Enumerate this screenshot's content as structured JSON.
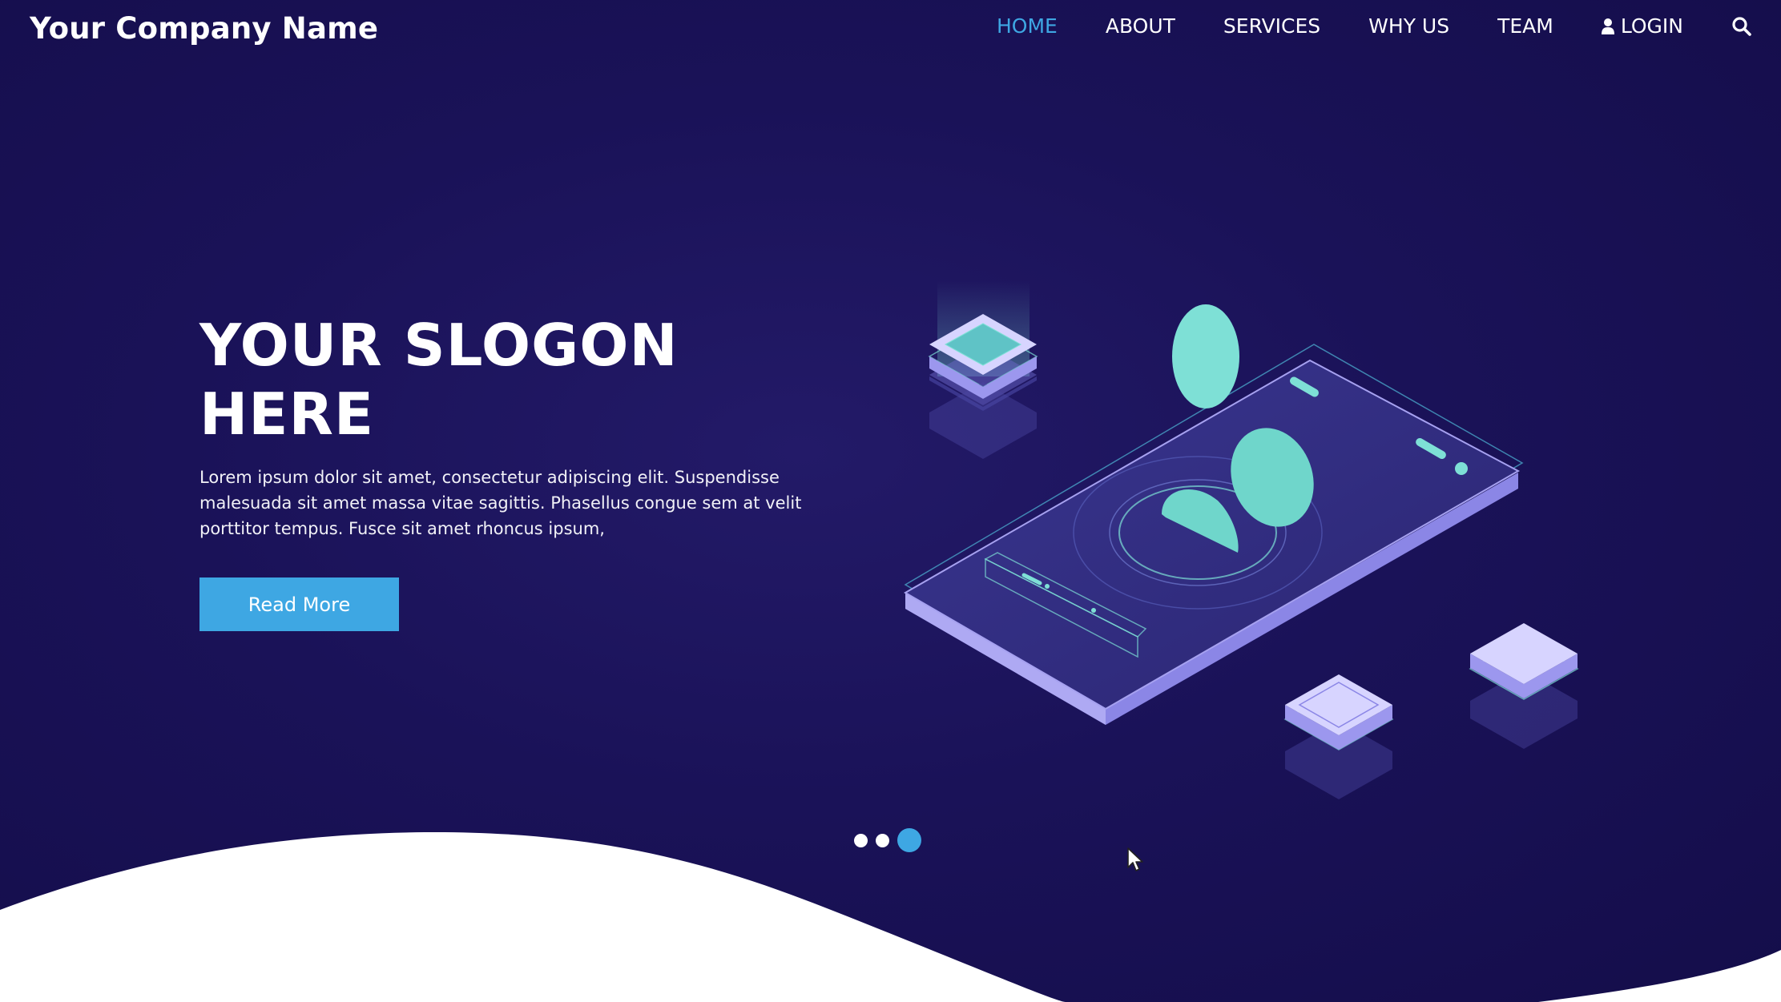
{
  "header": {
    "brand": "Your Company Name",
    "nav": [
      {
        "label": "HOME",
        "active": true
      },
      {
        "label": "ABOUT"
      },
      {
        "label": "SERVICES"
      },
      {
        "label": "WHY US"
      },
      {
        "label": "TEAM"
      }
    ],
    "login_label": "LOGIN",
    "login_icon": "user-icon",
    "search_icon": "search-icon"
  },
  "hero": {
    "title_line1": "YOUR SLOGON",
    "title_line2": "HERE",
    "text": "Lorem ipsum dolor sit amet, consectetur adipiscing elit. Suspendisse malesuada sit amet massa vitae sagittis. Phasellus congue sem at velit porttitor tempus. Fusce sit amet rhoncus ipsum,",
    "button_label": "Read More"
  },
  "slider": {
    "slides": 3,
    "active_index": 2
  },
  "colors": {
    "accent": "#3ea7e3",
    "background": "#1a1258",
    "mint": "#7ee0d6",
    "violet": "#8b86e6"
  }
}
